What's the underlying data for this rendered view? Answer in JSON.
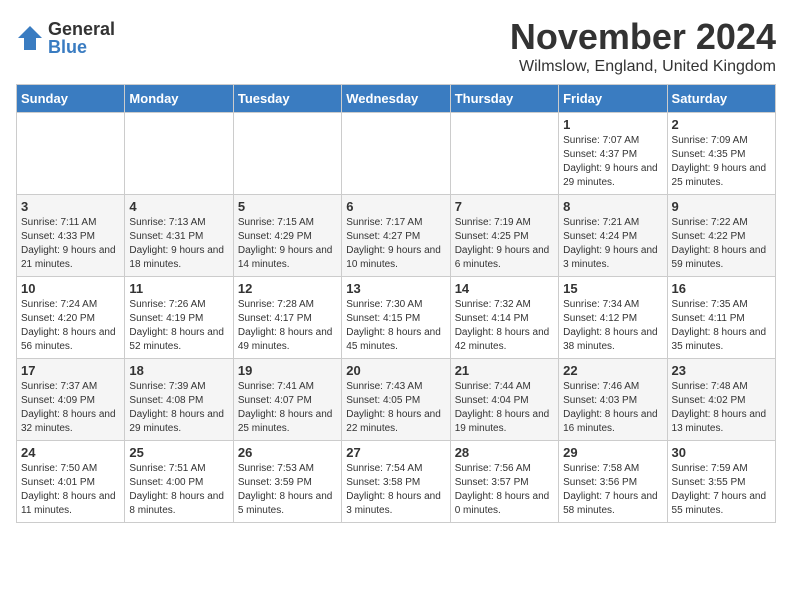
{
  "logo": {
    "general": "General",
    "blue": "Blue"
  },
  "header": {
    "month": "November 2024",
    "location": "Wilmslow, England, United Kingdom"
  },
  "days_of_week": [
    "Sunday",
    "Monday",
    "Tuesday",
    "Wednesday",
    "Thursday",
    "Friday",
    "Saturday"
  ],
  "weeks": [
    [
      {
        "day": "",
        "info": ""
      },
      {
        "day": "",
        "info": ""
      },
      {
        "day": "",
        "info": ""
      },
      {
        "day": "",
        "info": ""
      },
      {
        "day": "",
        "info": ""
      },
      {
        "day": "1",
        "info": "Sunrise: 7:07 AM\nSunset: 4:37 PM\nDaylight: 9 hours and 29 minutes."
      },
      {
        "day": "2",
        "info": "Sunrise: 7:09 AM\nSunset: 4:35 PM\nDaylight: 9 hours and 25 minutes."
      }
    ],
    [
      {
        "day": "3",
        "info": "Sunrise: 7:11 AM\nSunset: 4:33 PM\nDaylight: 9 hours and 21 minutes."
      },
      {
        "day": "4",
        "info": "Sunrise: 7:13 AM\nSunset: 4:31 PM\nDaylight: 9 hours and 18 minutes."
      },
      {
        "day": "5",
        "info": "Sunrise: 7:15 AM\nSunset: 4:29 PM\nDaylight: 9 hours and 14 minutes."
      },
      {
        "day": "6",
        "info": "Sunrise: 7:17 AM\nSunset: 4:27 PM\nDaylight: 9 hours and 10 minutes."
      },
      {
        "day": "7",
        "info": "Sunrise: 7:19 AM\nSunset: 4:25 PM\nDaylight: 9 hours and 6 minutes."
      },
      {
        "day": "8",
        "info": "Sunrise: 7:21 AM\nSunset: 4:24 PM\nDaylight: 9 hours and 3 minutes."
      },
      {
        "day": "9",
        "info": "Sunrise: 7:22 AM\nSunset: 4:22 PM\nDaylight: 8 hours and 59 minutes."
      }
    ],
    [
      {
        "day": "10",
        "info": "Sunrise: 7:24 AM\nSunset: 4:20 PM\nDaylight: 8 hours and 56 minutes."
      },
      {
        "day": "11",
        "info": "Sunrise: 7:26 AM\nSunset: 4:19 PM\nDaylight: 8 hours and 52 minutes."
      },
      {
        "day": "12",
        "info": "Sunrise: 7:28 AM\nSunset: 4:17 PM\nDaylight: 8 hours and 49 minutes."
      },
      {
        "day": "13",
        "info": "Sunrise: 7:30 AM\nSunset: 4:15 PM\nDaylight: 8 hours and 45 minutes."
      },
      {
        "day": "14",
        "info": "Sunrise: 7:32 AM\nSunset: 4:14 PM\nDaylight: 8 hours and 42 minutes."
      },
      {
        "day": "15",
        "info": "Sunrise: 7:34 AM\nSunset: 4:12 PM\nDaylight: 8 hours and 38 minutes."
      },
      {
        "day": "16",
        "info": "Sunrise: 7:35 AM\nSunset: 4:11 PM\nDaylight: 8 hours and 35 minutes."
      }
    ],
    [
      {
        "day": "17",
        "info": "Sunrise: 7:37 AM\nSunset: 4:09 PM\nDaylight: 8 hours and 32 minutes."
      },
      {
        "day": "18",
        "info": "Sunrise: 7:39 AM\nSunset: 4:08 PM\nDaylight: 8 hours and 29 minutes."
      },
      {
        "day": "19",
        "info": "Sunrise: 7:41 AM\nSunset: 4:07 PM\nDaylight: 8 hours and 25 minutes."
      },
      {
        "day": "20",
        "info": "Sunrise: 7:43 AM\nSunset: 4:05 PM\nDaylight: 8 hours and 22 minutes."
      },
      {
        "day": "21",
        "info": "Sunrise: 7:44 AM\nSunset: 4:04 PM\nDaylight: 8 hours and 19 minutes."
      },
      {
        "day": "22",
        "info": "Sunrise: 7:46 AM\nSunset: 4:03 PM\nDaylight: 8 hours and 16 minutes."
      },
      {
        "day": "23",
        "info": "Sunrise: 7:48 AM\nSunset: 4:02 PM\nDaylight: 8 hours and 13 minutes."
      }
    ],
    [
      {
        "day": "24",
        "info": "Sunrise: 7:50 AM\nSunset: 4:01 PM\nDaylight: 8 hours and 11 minutes."
      },
      {
        "day": "25",
        "info": "Sunrise: 7:51 AM\nSunset: 4:00 PM\nDaylight: 8 hours and 8 minutes."
      },
      {
        "day": "26",
        "info": "Sunrise: 7:53 AM\nSunset: 3:59 PM\nDaylight: 8 hours and 5 minutes."
      },
      {
        "day": "27",
        "info": "Sunrise: 7:54 AM\nSunset: 3:58 PM\nDaylight: 8 hours and 3 minutes."
      },
      {
        "day": "28",
        "info": "Sunrise: 7:56 AM\nSunset: 3:57 PM\nDaylight: 8 hours and 0 minutes."
      },
      {
        "day": "29",
        "info": "Sunrise: 7:58 AM\nSunset: 3:56 PM\nDaylight: 7 hours and 58 minutes."
      },
      {
        "day": "30",
        "info": "Sunrise: 7:59 AM\nSunset: 3:55 PM\nDaylight: 7 hours and 55 minutes."
      }
    ]
  ]
}
